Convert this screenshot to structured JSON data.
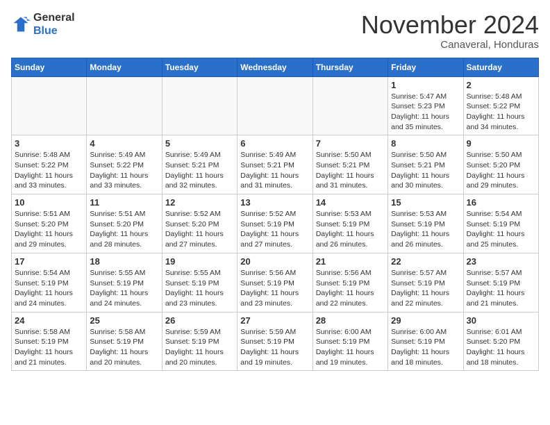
{
  "header": {
    "logo_general": "General",
    "logo_blue": "Blue",
    "month_title": "November 2024",
    "location": "Canaveral, Honduras"
  },
  "weekdays": [
    "Sunday",
    "Monday",
    "Tuesday",
    "Wednesday",
    "Thursday",
    "Friday",
    "Saturday"
  ],
  "weeks": [
    [
      {
        "day": "",
        "info": ""
      },
      {
        "day": "",
        "info": ""
      },
      {
        "day": "",
        "info": ""
      },
      {
        "day": "",
        "info": ""
      },
      {
        "day": "",
        "info": ""
      },
      {
        "day": "1",
        "info": "Sunrise: 5:47 AM\nSunset: 5:23 PM\nDaylight: 11 hours\nand 35 minutes."
      },
      {
        "day": "2",
        "info": "Sunrise: 5:48 AM\nSunset: 5:22 PM\nDaylight: 11 hours\nand 34 minutes."
      }
    ],
    [
      {
        "day": "3",
        "info": "Sunrise: 5:48 AM\nSunset: 5:22 PM\nDaylight: 11 hours\nand 33 minutes."
      },
      {
        "day": "4",
        "info": "Sunrise: 5:49 AM\nSunset: 5:22 PM\nDaylight: 11 hours\nand 33 minutes."
      },
      {
        "day": "5",
        "info": "Sunrise: 5:49 AM\nSunset: 5:21 PM\nDaylight: 11 hours\nand 32 minutes."
      },
      {
        "day": "6",
        "info": "Sunrise: 5:49 AM\nSunset: 5:21 PM\nDaylight: 11 hours\nand 31 minutes."
      },
      {
        "day": "7",
        "info": "Sunrise: 5:50 AM\nSunset: 5:21 PM\nDaylight: 11 hours\nand 31 minutes."
      },
      {
        "day": "8",
        "info": "Sunrise: 5:50 AM\nSunset: 5:21 PM\nDaylight: 11 hours\nand 30 minutes."
      },
      {
        "day": "9",
        "info": "Sunrise: 5:50 AM\nSunset: 5:20 PM\nDaylight: 11 hours\nand 29 minutes."
      }
    ],
    [
      {
        "day": "10",
        "info": "Sunrise: 5:51 AM\nSunset: 5:20 PM\nDaylight: 11 hours\nand 29 minutes."
      },
      {
        "day": "11",
        "info": "Sunrise: 5:51 AM\nSunset: 5:20 PM\nDaylight: 11 hours\nand 28 minutes."
      },
      {
        "day": "12",
        "info": "Sunrise: 5:52 AM\nSunset: 5:20 PM\nDaylight: 11 hours\nand 27 minutes."
      },
      {
        "day": "13",
        "info": "Sunrise: 5:52 AM\nSunset: 5:19 PM\nDaylight: 11 hours\nand 27 minutes."
      },
      {
        "day": "14",
        "info": "Sunrise: 5:53 AM\nSunset: 5:19 PM\nDaylight: 11 hours\nand 26 minutes."
      },
      {
        "day": "15",
        "info": "Sunrise: 5:53 AM\nSunset: 5:19 PM\nDaylight: 11 hours\nand 26 minutes."
      },
      {
        "day": "16",
        "info": "Sunrise: 5:54 AM\nSunset: 5:19 PM\nDaylight: 11 hours\nand 25 minutes."
      }
    ],
    [
      {
        "day": "17",
        "info": "Sunrise: 5:54 AM\nSunset: 5:19 PM\nDaylight: 11 hours\nand 24 minutes."
      },
      {
        "day": "18",
        "info": "Sunrise: 5:55 AM\nSunset: 5:19 PM\nDaylight: 11 hours\nand 24 minutes."
      },
      {
        "day": "19",
        "info": "Sunrise: 5:55 AM\nSunset: 5:19 PM\nDaylight: 11 hours\nand 23 minutes."
      },
      {
        "day": "20",
        "info": "Sunrise: 5:56 AM\nSunset: 5:19 PM\nDaylight: 11 hours\nand 23 minutes."
      },
      {
        "day": "21",
        "info": "Sunrise: 5:56 AM\nSunset: 5:19 PM\nDaylight: 11 hours\nand 22 minutes."
      },
      {
        "day": "22",
        "info": "Sunrise: 5:57 AM\nSunset: 5:19 PM\nDaylight: 11 hours\nand 22 minutes."
      },
      {
        "day": "23",
        "info": "Sunrise: 5:57 AM\nSunset: 5:19 PM\nDaylight: 11 hours\nand 21 minutes."
      }
    ],
    [
      {
        "day": "24",
        "info": "Sunrise: 5:58 AM\nSunset: 5:19 PM\nDaylight: 11 hours\nand 21 minutes."
      },
      {
        "day": "25",
        "info": "Sunrise: 5:58 AM\nSunset: 5:19 PM\nDaylight: 11 hours\nand 20 minutes."
      },
      {
        "day": "26",
        "info": "Sunrise: 5:59 AM\nSunset: 5:19 PM\nDaylight: 11 hours\nand 20 minutes."
      },
      {
        "day": "27",
        "info": "Sunrise: 5:59 AM\nSunset: 5:19 PM\nDaylight: 11 hours\nand 19 minutes."
      },
      {
        "day": "28",
        "info": "Sunrise: 6:00 AM\nSunset: 5:19 PM\nDaylight: 11 hours\nand 19 minutes."
      },
      {
        "day": "29",
        "info": "Sunrise: 6:00 AM\nSunset: 5:19 PM\nDaylight: 11 hours\nand 18 minutes."
      },
      {
        "day": "30",
        "info": "Sunrise: 6:01 AM\nSunset: 5:20 PM\nDaylight: 11 hours\nand 18 minutes."
      }
    ]
  ]
}
